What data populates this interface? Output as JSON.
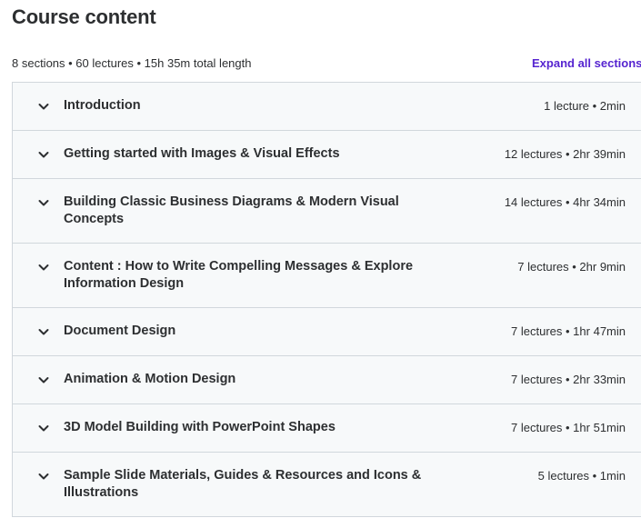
{
  "course_content": {
    "title": "Course content",
    "summary": "8 sections • 60 lectures • 15h 35m total length",
    "expand_all_label": "Expand all sections",
    "sections": [
      {
        "title": "Introduction",
        "meta": "1 lecture • 2min"
      },
      {
        "title": "Getting started with Images & Visual Effects",
        "meta": "12 lectures • 2hr 39min"
      },
      {
        "title": "Building Classic Business Diagrams & Modern Visual Concepts",
        "meta": "14 lectures • 4hr 34min"
      },
      {
        "title": "Content : How to Write Compelling Messages & Explore Information Design",
        "meta": "7 lectures • 2hr 9min"
      },
      {
        "title": "Document Design",
        "meta": "7 lectures • 1hr 47min"
      },
      {
        "title": "Animation & Motion Design",
        "meta": "7 lectures • 2hr 33min"
      },
      {
        "title": "3D Model Building with PowerPoint Shapes",
        "meta": "7 lectures • 1hr 51min"
      },
      {
        "title": "Sample Slide Materials, Guides & Resources and Icons & Illustrations",
        "meta": "5 lectures • 1min"
      }
    ]
  },
  "colors": {
    "accent": "#5624d0",
    "text": "#2d2f31",
    "section_bg": "#f7f9fa",
    "border": "#d1d7dc"
  },
  "icons": {
    "section_toggle": "chevron-down-icon"
  }
}
